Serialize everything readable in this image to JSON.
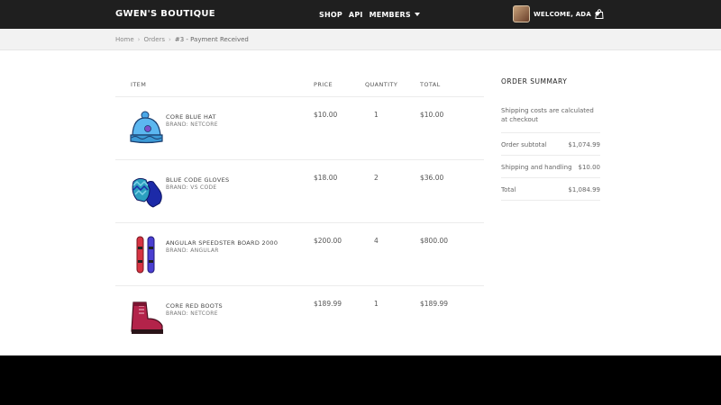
{
  "header": {
    "brand": "GWEN'S BOUTIQUE",
    "nav": [
      "SHOP",
      "API",
      "MEMBERS"
    ],
    "user_label": "WELCOME, ADA",
    "cart_icon": "shopping-bag-icon"
  },
  "breadcrumb": {
    "items": [
      "Home",
      "Orders",
      "#3 - Payment Received"
    ],
    "separator": "›"
  },
  "table": {
    "headers": {
      "item": "ITEM",
      "price": "PRICE",
      "quantity": "QUANTITY",
      "total": "TOTAL"
    },
    "rows": [
      {
        "name": "CORE BLUE HAT",
        "brand": "BRAND: NETCORE",
        "price": "$10.00",
        "quantity": "1",
        "total": "$10.00",
        "icon": "blue-hat-icon"
      },
      {
        "name": "BLUE CODE GLOVES",
        "brand": "BRAND: VS CODE",
        "price": "$18.00",
        "quantity": "2",
        "total": "$36.00",
        "icon": "gloves-icon"
      },
      {
        "name": "ANGULAR SPEEDSTER BOARD 2000",
        "brand": "BRAND: ANGULAR",
        "price": "$200.00",
        "quantity": "4",
        "total": "$800.00",
        "icon": "snowboard-icon"
      },
      {
        "name": "CORE RED BOOTS",
        "brand": "BRAND: NETCORE",
        "price": "$189.99",
        "quantity": "1",
        "total": "$189.99",
        "icon": "red-boots-icon"
      }
    ]
  },
  "summary": {
    "title": "ORDER SUMMARY",
    "note": "Shipping costs are calculated at checkout",
    "subtotal_label": "Order subtotal",
    "subtotal": "$1,074.99",
    "shipping_label": "Shipping and handling",
    "shipping": "$10.00",
    "total_label": "Total",
    "total": "$1,084.99"
  }
}
